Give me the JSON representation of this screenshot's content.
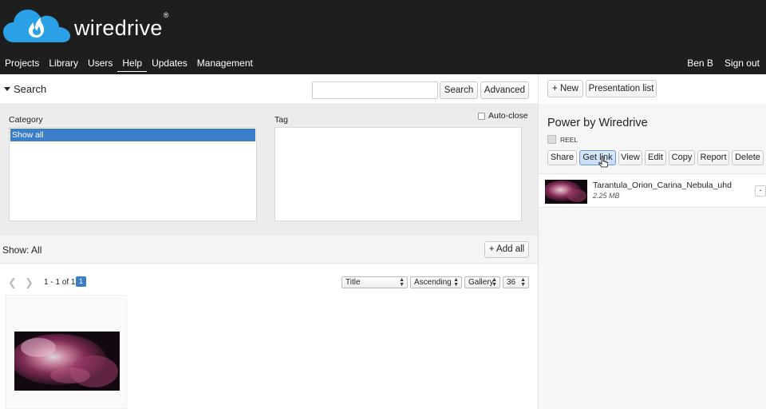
{
  "header": {
    "brand": "wiredrive",
    "brand_mark": "®",
    "nav": [
      "Projects",
      "Library",
      "Users",
      "Help",
      "Updates",
      "Management"
    ],
    "user": "Ben B",
    "signout": "Sign out"
  },
  "search": {
    "toggle_label": "Search",
    "input_value": "",
    "search_button": "Search",
    "advanced_button": "Advanced"
  },
  "filters": {
    "category_label": "Category",
    "category_selected": "Show all",
    "tag_label": "Tag",
    "autoclose_label": "Auto-close"
  },
  "results": {
    "show_label": "Show: All",
    "add_all": "+ Add all",
    "range": "1 - 1 of 1",
    "page": "1",
    "sort_field": "Title",
    "sort_order": "Ascending",
    "view_mode": "Gallery",
    "per_page": "36"
  },
  "presentation": {
    "new_button": "+ New",
    "list_button": "Presentation list",
    "title": "Power by Wiredrive",
    "type": "REEL",
    "actions": [
      "Share",
      "Get link",
      "View",
      "Edit",
      "Copy",
      "Report",
      "Delete"
    ],
    "item_name": "Tarantula_Orion_Carina_Nebula_uhd",
    "item_size": "2.25 MB",
    "remove_label": "-"
  },
  "colors": {
    "header_bg": "#1e1e1e",
    "accent_blue": "#3a7dc8",
    "logo_blue": "#2aa0e6"
  }
}
